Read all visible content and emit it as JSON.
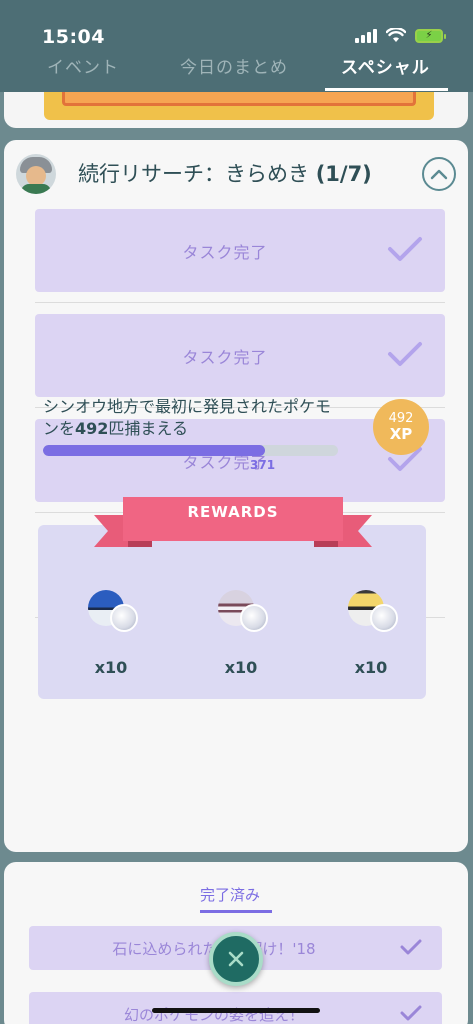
{
  "status_bar": {
    "time": "15:04"
  },
  "tabs": [
    {
      "label": "イベント"
    },
    {
      "label": "今日のまとめ"
    },
    {
      "label": "スペシャル"
    }
  ],
  "research": {
    "title": "続行リサーチ：きらめき",
    "step": "(1/7)",
    "tasks": [
      {
        "label": "タスク完了"
      },
      {
        "label": "タスク完了"
      },
      {
        "label": "タスク完了"
      }
    ],
    "current_task": {
      "text_before": "シンオウ地方で最初に発見されたポケモンを",
      "target": "492",
      "text_after": "匹捕まえる",
      "progress_value": "371",
      "progress_ratio": 0.754
    },
    "xp": {
      "amount": "492",
      "label": "XP"
    },
    "rewards": {
      "title": "REWARDS",
      "items": [
        {
          "icon": "great-ball-icon",
          "qty": "x10"
        },
        {
          "icon": "premier-ball-icon",
          "qty": "x10"
        },
        {
          "icon": "ultra-ball-icon",
          "qty": "x10"
        }
      ]
    }
  },
  "completed": {
    "title": "完了済み",
    "items": [
      {
        "label": "石に込められた謎を解け！'18"
      },
      {
        "label": "幻のポケモンの姿を追え！"
      }
    ]
  },
  "colors": {
    "header": "#4d6e75",
    "task_bg": "#dcd4f3",
    "accent_purple": "#7b6de3",
    "xp_badge": "#f0b95b",
    "ribbon": "#e85c79"
  }
}
